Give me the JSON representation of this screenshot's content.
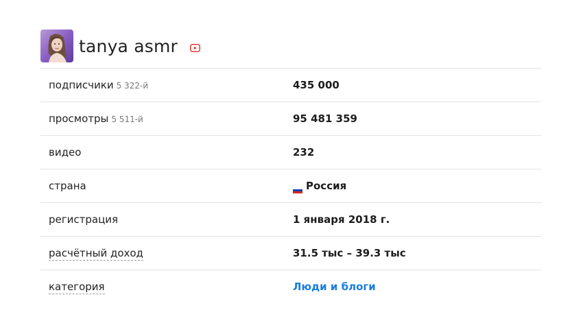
{
  "channel": {
    "name": "tanya asmr",
    "icons": {
      "avatar": "avatar-photo",
      "platform": "youtube-icon"
    },
    "colors": {
      "youtube_red": "#e53935",
      "link_blue": "#1a7ee0"
    }
  },
  "stats": {
    "subscribers": {
      "label": "подписчики",
      "rank": "5 322-й",
      "value": "435 000"
    },
    "views": {
      "label": "просмотры",
      "rank": "5 511-й",
      "value": "95 481 359"
    },
    "videos": {
      "label": "видео",
      "value": "232"
    },
    "country": {
      "label": "страна",
      "value": "Россия",
      "flag_icon": "russia-flag-icon"
    },
    "registration": {
      "label": "регистрация",
      "value": "1 января 2018 г."
    },
    "income": {
      "label": "расчётный доход",
      "value": "31.5 тыс – 39.3 тыс"
    },
    "category": {
      "label": "категория",
      "value": "Люди и блоги"
    }
  }
}
